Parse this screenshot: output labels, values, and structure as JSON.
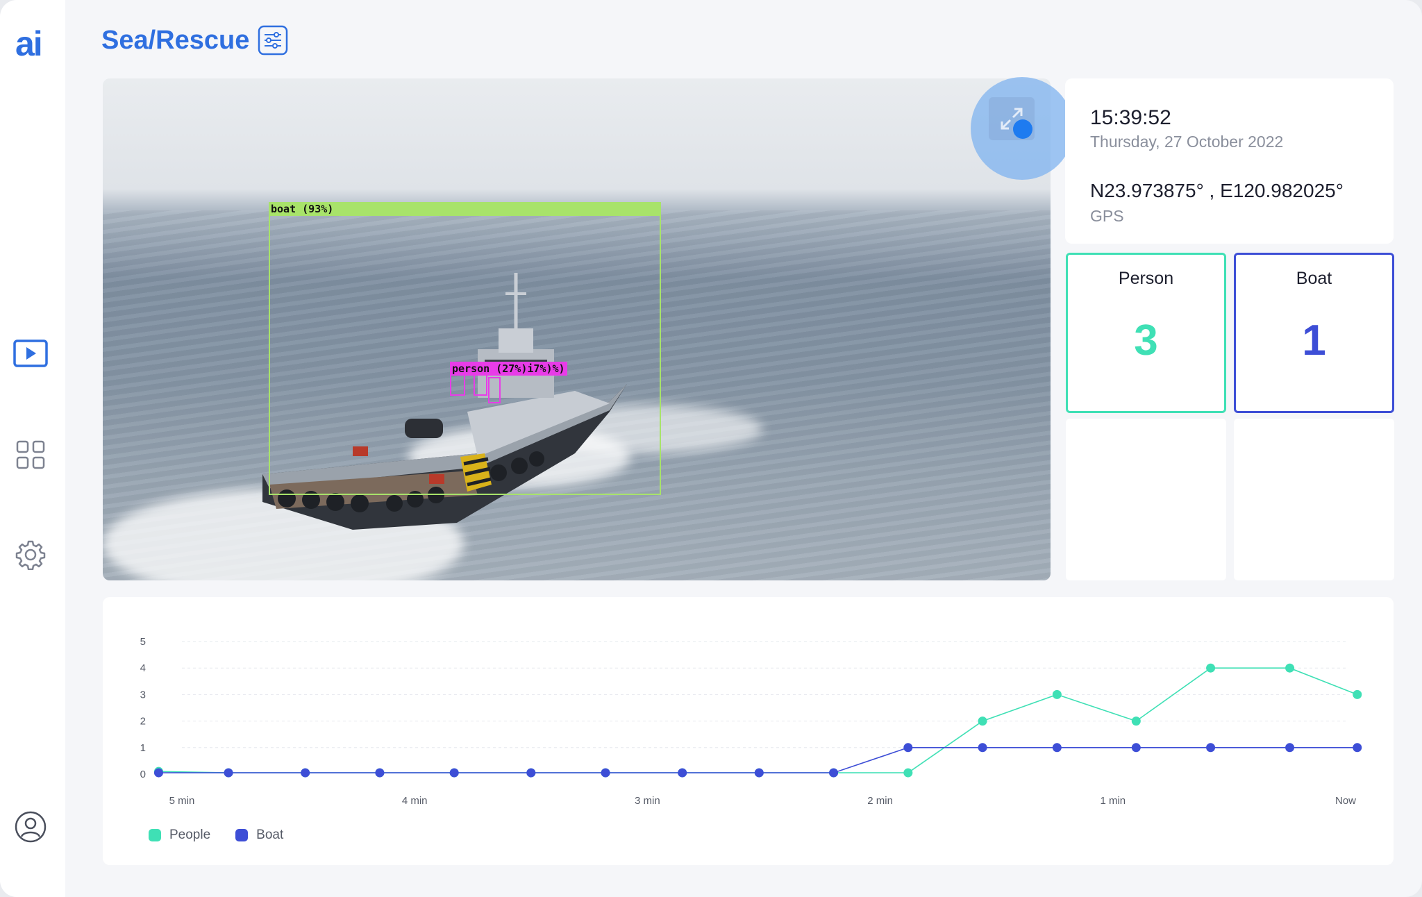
{
  "app": {
    "logo_text": "ai",
    "page_title": "Sea/Rescue"
  },
  "sidebar": {
    "items": [
      {
        "name": "live-video",
        "icon": "play-icon",
        "active": true
      },
      {
        "name": "dashboard",
        "icon": "grid-icon",
        "active": false
      },
      {
        "name": "settings",
        "icon": "gear-icon",
        "active": false
      },
      {
        "name": "profile",
        "icon": "user-icon",
        "active": false
      }
    ]
  },
  "video": {
    "detections": [
      {
        "label": "boat (93%)",
        "color": "#a8e36a"
      },
      {
        "label": "person (27%)i7%)%)",
        "color": "#e83ce8"
      }
    ]
  },
  "info": {
    "time": "15:39:52",
    "date": "Thursday, 27 October 2022",
    "coordinates": "N23.973875° , E120.982025°",
    "coordinates_label": "GPS"
  },
  "stats": {
    "person": {
      "label": "Person",
      "value": "3",
      "color": "#3fe0b5"
    },
    "boat": {
      "label": "Boat",
      "value": "1",
      "color": "#3d4ed6"
    }
  },
  "chart_data": {
    "type": "line",
    "x_ticks": [
      "5 min",
      "4 min",
      "3 min",
      "2 min",
      "1 min",
      "Now"
    ],
    "y_ticks": [
      0,
      1,
      2,
      3,
      4,
      5
    ],
    "ylim": [
      0,
      5
    ],
    "xlim": [
      -5,
      0
    ],
    "grid": true,
    "legend_position": "bottom-left",
    "series": [
      {
        "name": "People",
        "color": "#3fe0b5",
        "x": [
          -5.1,
          -4.8,
          -4.47,
          -4.15,
          -3.83,
          -3.5,
          -3.18,
          -2.85,
          -2.52,
          -2.2,
          -1.88,
          -1.56,
          -1.24,
          -0.9,
          -0.58,
          -0.24,
          0.05
        ],
        "y": [
          0.1,
          0.05,
          0.05,
          0.05,
          0.05,
          0.05,
          0.05,
          0.05,
          0.05,
          0.05,
          0.05,
          2,
          3,
          2,
          4,
          4,
          3
        ]
      },
      {
        "name": "Boat",
        "color": "#3d4ed6",
        "x": [
          -5.1,
          -4.8,
          -4.47,
          -4.15,
          -3.83,
          -3.5,
          -3.18,
          -2.85,
          -2.52,
          -2.2,
          -1.88,
          -1.56,
          -1.24,
          -0.9,
          -0.58,
          -0.24,
          0.05
        ],
        "y": [
          0.05,
          0.05,
          0.05,
          0.05,
          0.05,
          0.05,
          0.05,
          0.05,
          0.05,
          0.05,
          1,
          1,
          1,
          1,
          1,
          1,
          1
        ]
      }
    ]
  }
}
